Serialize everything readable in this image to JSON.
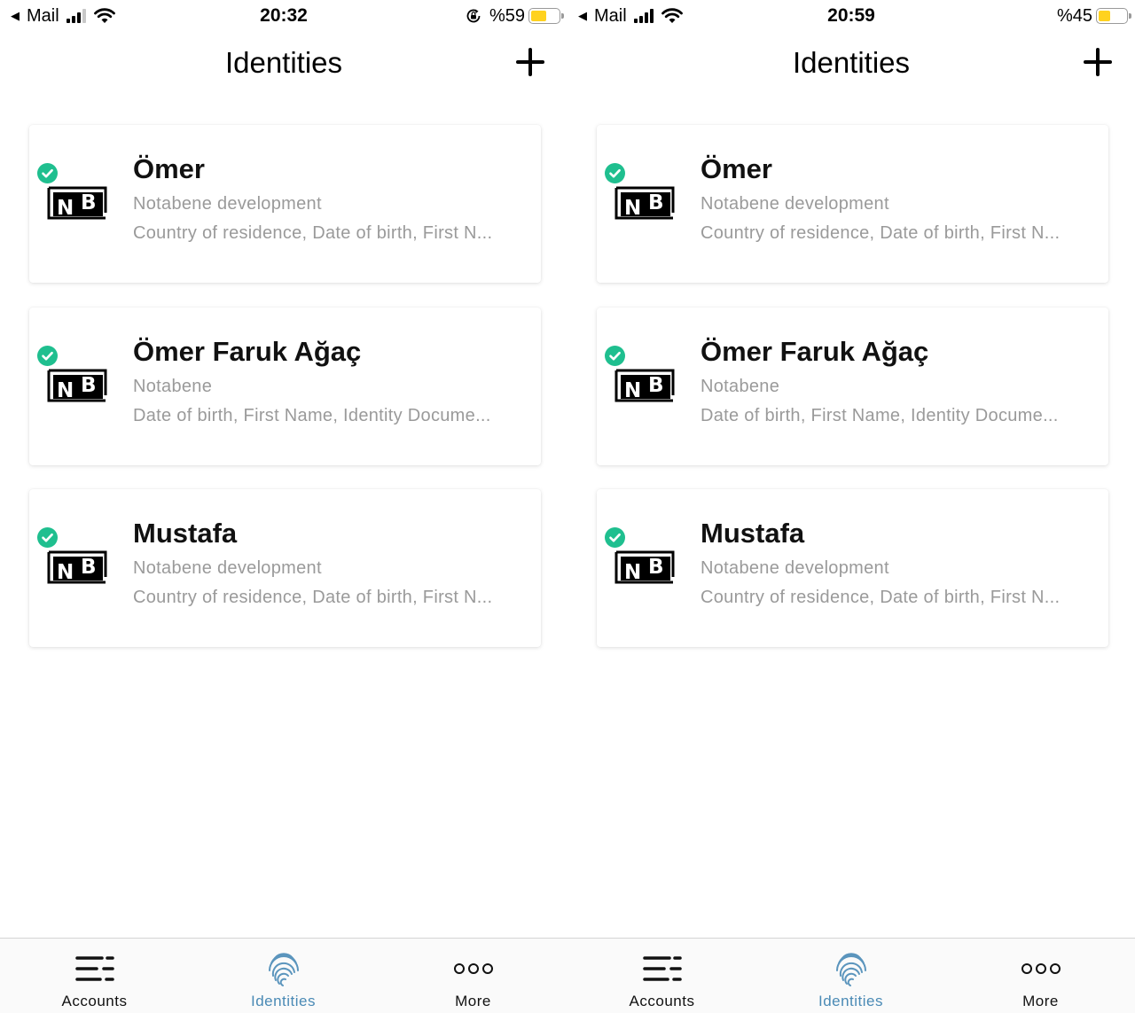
{
  "colors": {
    "verified": "#1fbf8f",
    "secondary_text": "#9a9a9a",
    "active_tab": "#4a8ab5",
    "battery_fill": "#ffd21f"
  },
  "screens": [
    {
      "status": {
        "back_app": "Mail",
        "time": "20:32",
        "battery": "%59",
        "battery_level": 0.59,
        "rotation_lock": true,
        "signal_bars": 3
      },
      "header": {
        "title": "Identities",
        "add_icon": "plus-icon"
      },
      "identities": [
        {
          "name": "Ömer",
          "org": "Notabene development",
          "attributes": "Country of residence, Date of birth, First N...",
          "logo": "NB",
          "verified": true
        },
        {
          "name": "Ömer Faruk Ağaç",
          "org": "Notabene",
          "attributes": "Date of birth, First Name, Identity Docume...",
          "logo": "NB",
          "verified": true
        },
        {
          "name": "Mustafa",
          "org": "Notabene development",
          "attributes": "Country of residence, Date of birth, First N...",
          "logo": "NB",
          "verified": true
        }
      ],
      "tabs": [
        {
          "label": "Accounts",
          "icon": "list-icon",
          "active": false
        },
        {
          "label": "Identities",
          "icon": "fingerprint-icon",
          "active": true
        },
        {
          "label": "More",
          "icon": "more-icon",
          "active": false
        }
      ]
    },
    {
      "status": {
        "back_app": "Mail",
        "time": "20:59",
        "battery": "%45",
        "battery_level": 0.45,
        "rotation_lock": false,
        "signal_bars": 4
      },
      "header": {
        "title": "Identities",
        "add_icon": "plus-icon"
      },
      "identities": [
        {
          "name": "Ömer",
          "org": "Notabene development",
          "attributes": "Country of residence, Date of birth, First N...",
          "logo": "NB",
          "verified": true
        },
        {
          "name": "Ömer Faruk Ağaç",
          "org": "Notabene",
          "attributes": "Date of birth, First Name, Identity Docume...",
          "logo": "NB",
          "verified": true
        },
        {
          "name": "Mustafa",
          "org": "Notabene development",
          "attributes": "Country of residence, Date of birth, First N...",
          "logo": "NB",
          "verified": true
        }
      ],
      "tabs": [
        {
          "label": "Accounts",
          "icon": "list-icon",
          "active": false
        },
        {
          "label": "Identities",
          "icon": "fingerprint-icon",
          "active": true
        },
        {
          "label": "More",
          "icon": "more-icon",
          "active": false
        }
      ]
    }
  ]
}
